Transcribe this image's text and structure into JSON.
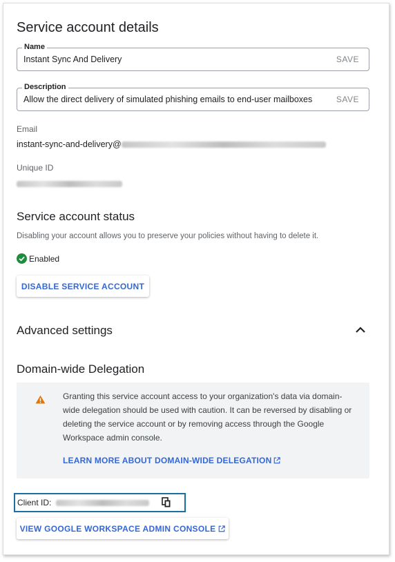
{
  "header": {
    "title": "Service account details"
  },
  "name_field": {
    "label": "Name",
    "value": "Instant Sync And Delivery",
    "save_label": "SAVE"
  },
  "description_field": {
    "label": "Description",
    "value": "Allow the direct delivery of simulated phishing emails to end-user mailboxes",
    "save_label": "SAVE"
  },
  "email": {
    "label": "Email",
    "prefix": "instant-sync-and-delivery@"
  },
  "unique_id": {
    "label": "Unique ID"
  },
  "status": {
    "title": "Service account status",
    "hint": "Disabling your account allows you to preserve your policies without having to delete it.",
    "state": "Enabled",
    "state_color": "#1e8e3e",
    "disable_button": "DISABLE SERVICE ACCOUNT"
  },
  "advanced": {
    "title": "Advanced settings",
    "toggle_icon": "chevron-up-icon"
  },
  "delegation": {
    "title": "Domain-wide Delegation",
    "warning_icon": "warning-icon",
    "warning_color": "#e37400",
    "message": "Granting this service account access to your organization's data via domain-wide delegation should be used with caution. It can be reversed by disabling or deleting the service account or by removing access through the Google Workspace admin console.",
    "learn_more": "LEARN MORE ABOUT DOMAIN-WIDE DELEGATION",
    "client_id_label": "Client ID:",
    "copy_icon": "copy-icon",
    "console_button": "VIEW GOOGLE WORKSPACE ADMIN CONSOLE"
  },
  "colors": {
    "accent": "#3367d6",
    "highlight_border": "#1a6ea8"
  }
}
